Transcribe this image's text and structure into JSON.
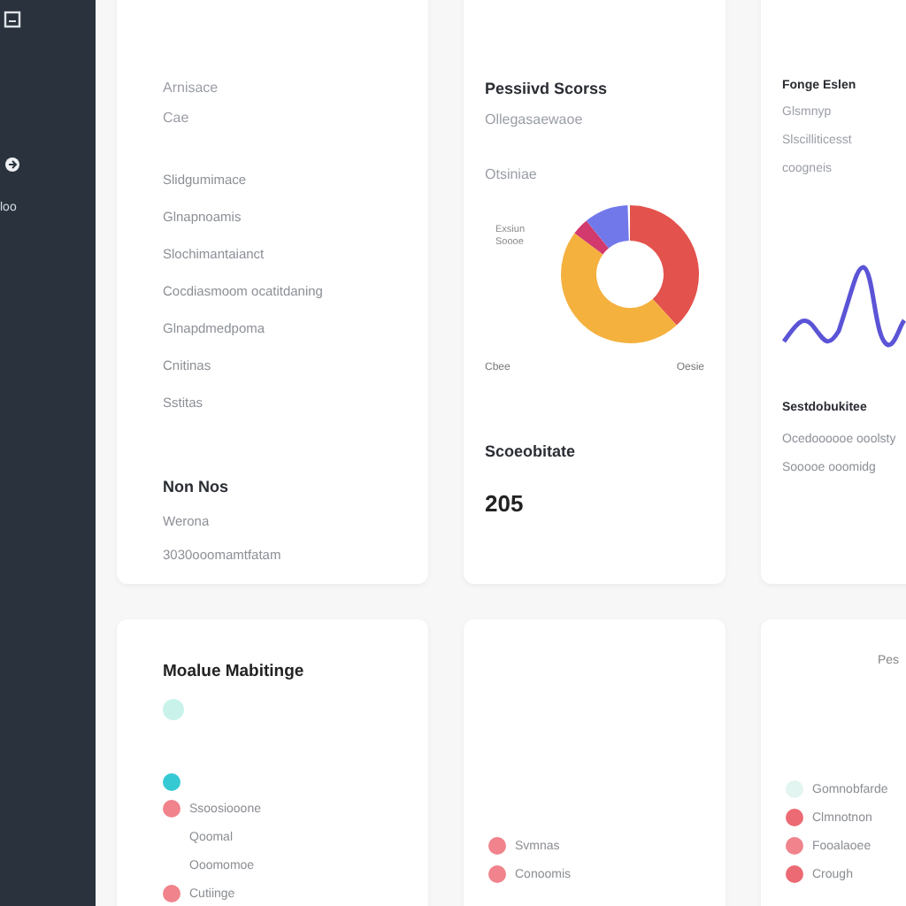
{
  "sidebar": {
    "items": [
      {
        "label": "loo"
      }
    ]
  },
  "cards": [
    {
      "kind": "list",
      "title": "Arnisace",
      "subtitle": "Cae",
      "items": [
        "Slidgumimace",
        "Glnapnoamis",
        "Slochimantaianct",
        "Cocdiasmoom ocatitdaning",
        "Glnapdmedpoma",
        "Cnitinas",
        "Sstitas"
      ],
      "footer_title": "Non Nos",
      "footer_lines": [
        "Werona",
        "3030ooomamtfatam"
      ]
    },
    {
      "kind": "donut",
      "title": "Pessiivd Scorss",
      "subtitle": "Ollegasaewaoe",
      "caption": "Otsiniae",
      "legend": "Exsiun Soooe",
      "labels": [
        "Cbee",
        "Oesie"
      ],
      "stat_title": "Scoeobitate",
      "stat_value": "205"
    },
    {
      "kind": "line",
      "title": "Fonge Eslen",
      "lines": [
        "Glsmnyp",
        "Slscilliticesst",
        "coogneis"
      ],
      "stat_title": "Sestdobukitee",
      "stat_lines": [
        "Ocedoooooe ooolsty",
        "Sooooe ooomidg"
      ]
    },
    {
      "kind": "status",
      "title": "Moalue Mabitinge",
      "items": [
        {
          "label": "Ssoosiooone",
          "color": "#f0838c"
        },
        {
          "label": "Qoomal"
        },
        {
          "label": "Ooomomoe"
        },
        {
          "label": "Cutiinge",
          "color": "#f0838c"
        }
      ]
    },
    {
      "kind": "status",
      "items": [
        {
          "label": "Svmnas",
          "color": "#f0838c"
        },
        {
          "label": "Conoomis",
          "color": "#f0838c"
        }
      ]
    },
    {
      "kind": "status",
      "title": "Pes",
      "items": [
        {
          "label": "Gomnobfarde",
          "color": "#e2f5f0"
        },
        {
          "label": "Clmnotnon",
          "color": "#ec6a73"
        },
        {
          "label": "Fooalaoee",
          "color": "#f0838c"
        },
        {
          "label": "Crough",
          "color": "#ec6a73"
        }
      ]
    }
  ]
}
